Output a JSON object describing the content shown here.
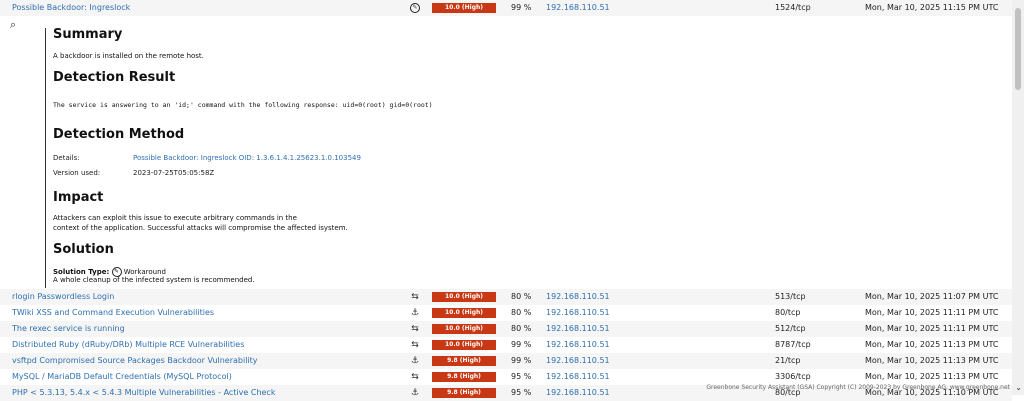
{
  "top_row": {
    "name": "Possible Backdoor: Ingreslock",
    "severity": "10.0 (High)",
    "qod": "99 %",
    "host": "192.168.110.51",
    "location": "1524/tcp",
    "created": "Mon, Mar 10, 2025 11:15 PM UTC",
    "solution_icon": "workaround-icon"
  },
  "details": {
    "summary_heading": "Summary",
    "summary_text": "A backdoor is installed on the remote host.",
    "detection_result_heading": "Detection Result",
    "detection_result_text": "The service is answering to an 'id;' command with the following response: uid=0(root) gid=0(root)",
    "detection_method_heading": "Detection Method",
    "details_label": "Details:",
    "details_value": "Possible Backdoor: Ingreslock OID: 1.3.6.1.4.1.25623.1.0.103549",
    "version_label": "Version used:",
    "version_value": "2023-07-25T05:05:58Z",
    "impact_heading": "Impact",
    "impact_line1": "Attackers can exploit this issue to execute arbitrary commands in the",
    "impact_line2": "context of the application. Successful attacks will compromise the affected isystem.",
    "solution_heading": "Solution",
    "solution_type_label": "Solution Type:",
    "solution_type_value": "Workaround",
    "solution_text": "A whole cleanup of the infected system is recommended."
  },
  "rows": [
    {
      "name": "rlogin Passwordless Login",
      "icon": "mitigation-icon",
      "glyph": "⇆",
      "severity": "10.0 (High)",
      "qod": "80 %",
      "host": "192.168.110.51",
      "location": "513/tcp",
      "created": "Mon, Mar 10, 2025 11:07 PM UTC"
    },
    {
      "name": "TWiki XSS and Command Execution Vulnerabilities",
      "icon": "vendorfix-icon",
      "glyph": "⚓",
      "severity": "10.0 (High)",
      "qod": "80 %",
      "host": "192.168.110.51",
      "location": "80/tcp",
      "created": "Mon, Mar 10, 2025 11:11 PM UTC"
    },
    {
      "name": "The rexec service is running",
      "icon": "mitigation-icon",
      "glyph": "⇆",
      "severity": "10.0 (High)",
      "qod": "80 %",
      "host": "192.168.110.51",
      "location": "512/tcp",
      "created": "Mon, Mar 10, 2025 11:11 PM UTC"
    },
    {
      "name": "Distributed Ruby (dRuby/DRb) Multiple RCE Vulnerabilities",
      "icon": "mitigation-icon",
      "glyph": "⇆",
      "severity": "10.0 (High)",
      "qod": "99 %",
      "host": "192.168.110.51",
      "location": "8787/tcp",
      "created": "Mon, Mar 10, 2025 11:13 PM UTC"
    },
    {
      "name": "vsftpd Compromised Source Packages Backdoor Vulnerability",
      "icon": "vendorfix-icon",
      "glyph": "⚓",
      "severity": "9.8 (High)",
      "qod": "99 %",
      "host": "192.168.110.51",
      "location": "21/tcp",
      "created": "Mon, Mar 10, 2025 11:13 PM UTC"
    },
    {
      "name": "MySQL / MariaDB Default Credentials (MySQL Protocol)",
      "icon": "mitigation-icon",
      "glyph": "⇆",
      "severity": "9.8 (High)",
      "qod": "95 %",
      "host": "192.168.110.51",
      "location": "3306/tcp",
      "created": "Mon, Mar 10, 2025 11:13 PM UTC"
    },
    {
      "name": "PHP < 5.3.13, 5.4.x < 5.4.3 Multiple Vulnerabilities - Active Check",
      "icon": "vendorfix-icon",
      "glyph": "⚓",
      "severity": "9.8 (High)",
      "qod": "95 %",
      "host": "192.168.110.51",
      "location": "80/tcp",
      "created": "Mon, Mar 10, 2025 11:10 PM UTC"
    }
  ],
  "footer": "Greenbone Security Assistant (GSA) Copyright (C) 2009-2023 by Greenbone AG, www.greenbone.net"
}
